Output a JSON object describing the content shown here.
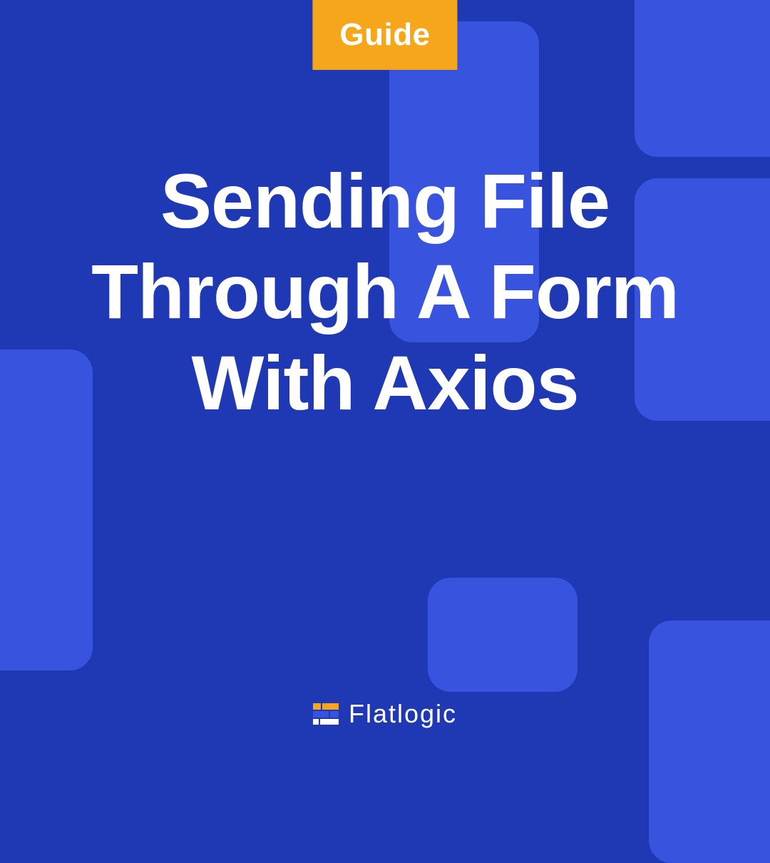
{
  "badge": {
    "label": "Guide"
  },
  "title": "Sending File Through A Form With Axios",
  "brand": {
    "name": "Flatlogic"
  },
  "colors": {
    "background": "#1f39b5",
    "shape": "#3853de",
    "badge_bg": "#f5a61a",
    "text": "#ffffff",
    "brand_orange": "#f5a61a",
    "brand_blue": "#3853de"
  }
}
